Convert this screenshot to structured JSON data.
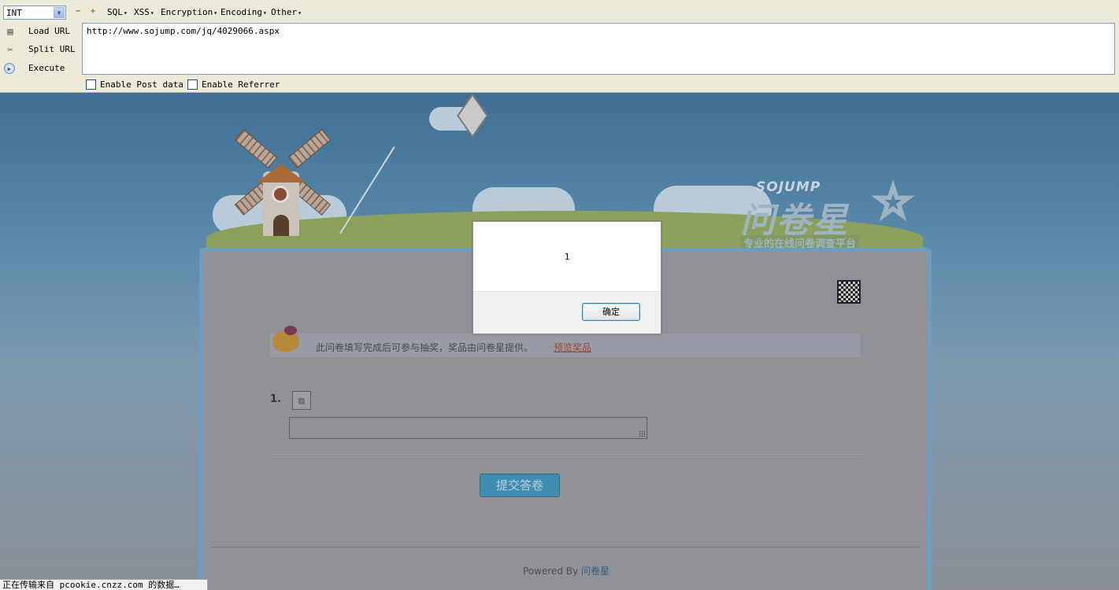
{
  "hackbar": {
    "type_select": "INT",
    "menus": [
      "SQL",
      "XSS",
      "Encryption",
      "Encoding",
      "Other"
    ],
    "load_url": "Load URL",
    "split_url": "Split URL",
    "execute": "Execute",
    "url": "http://www.sojump.com/jq/4029066.aspx",
    "enable_post": "Enable Post data",
    "enable_referrer": "Enable Referrer"
  },
  "banner": {
    "logo_en": "SOJUMP",
    "logo_cn": "问卷星",
    "tagline": "专业的在线问卷调查平台"
  },
  "survey": {
    "notice_text": "此问卷填写完成后可参与抽奖，奖品由问卷星提供。",
    "notice_link": "预览奖品",
    "question_number": "1.",
    "submit": "提交答卷",
    "powered_by": "Powered By",
    "powered_link": "问卷星"
  },
  "dialog": {
    "message": "1",
    "ok": "确定"
  },
  "status_bar": "正在传输来自 pcookie.cnzz.com 的数据…"
}
